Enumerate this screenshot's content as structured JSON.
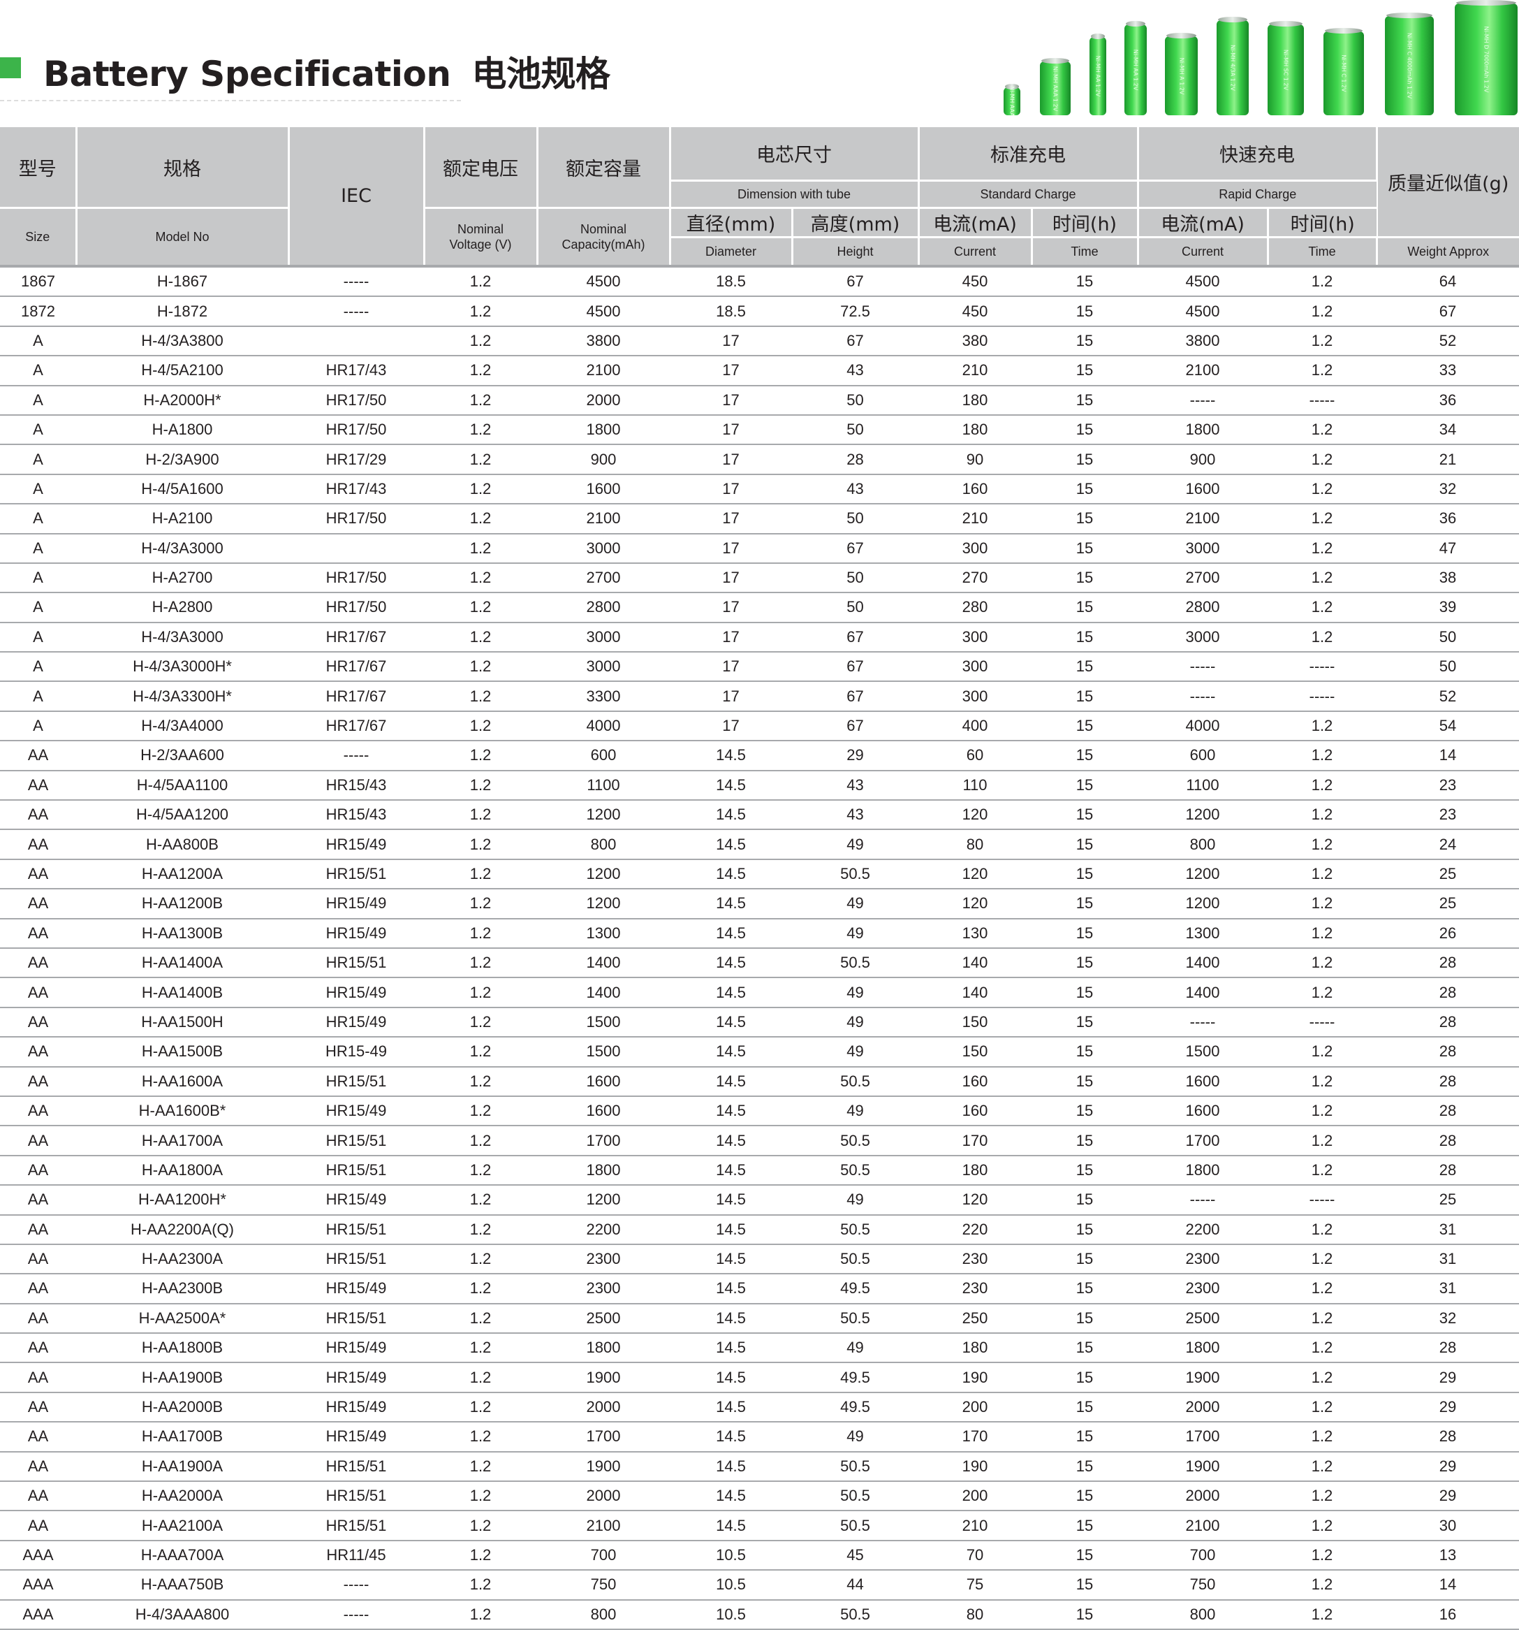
{
  "title": {
    "en": "Battery Specification",
    "zh": "电池规格"
  },
  "battery_labels": [
    "Ni-MH AAA",
    "Ni-MH AAA 1.2V",
    "Ni-MH AA 1.2V",
    "Ni-MH AA 1.2V",
    "Ni-MH A 1.2V",
    "Ni-MH 4/3A 1.2V",
    "Ni-MH SC 1.2V",
    "Ni-MH C 1.2V",
    "Ni-MH C 4000mAh 1.2V",
    "Ni-MH D 7000mAh 1.2V"
  ],
  "header": {
    "size": {
      "zh": "型号",
      "en": "Size"
    },
    "model": {
      "zh": "规格",
      "en": "Model No"
    },
    "iec": "IEC",
    "voltage": {
      "zh": "额定电压",
      "en1": "Nominal",
      "en2": "Voltage (V)"
    },
    "capacity": {
      "zh": "额定容量",
      "en1": "Nominal",
      "en2": "Capacity(mAh)"
    },
    "dimension": {
      "zh": "电芯尺寸",
      "en": "Dimension with tube"
    },
    "diameter": {
      "zh": "直径(mm)",
      "en": "Diameter"
    },
    "height": {
      "zh": "高度(mm)",
      "en": "Height"
    },
    "std_charge": {
      "zh": "标准充电",
      "en": "Standard Charge"
    },
    "std_current": {
      "zh": "电流(mA)",
      "en": "Current"
    },
    "std_time": {
      "zh": "时间(h)",
      "en": "Time"
    },
    "rapid_charge": {
      "zh": "快速充电",
      "en": "Rapid Charge"
    },
    "rapid_current": {
      "zh": "电流(mA)",
      "en": "Current"
    },
    "rapid_time": {
      "zh": "时间(h)",
      "en": "Time"
    },
    "weight": {
      "zh": "质量近似值(g)",
      "en": "Weight Approx"
    }
  },
  "rows": [
    [
      "1867",
      "H-1867",
      "-----",
      "1.2",
      "4500",
      "18.5",
      "67",
      "450",
      "15",
      "4500",
      "1.2",
      "64"
    ],
    [
      "1872",
      "H-1872",
      "-----",
      "1.2",
      "4500",
      "18.5",
      "72.5",
      "450",
      "15",
      "4500",
      "1.2",
      "67"
    ],
    [
      "A",
      "H-4/3A3800",
      "",
      "1.2",
      "3800",
      "17",
      "67",
      "380",
      "15",
      "3800",
      "1.2",
      "52"
    ],
    [
      "A",
      "H-4/5A2100",
      "HR17/43",
      "1.2",
      "2100",
      "17",
      "43",
      "210",
      "15",
      "2100",
      "1.2",
      "33"
    ],
    [
      "A",
      "H-A2000H*",
      "HR17/50",
      "1.2",
      "2000",
      "17",
      "50",
      "180",
      "15",
      "-----",
      "-----",
      "36"
    ],
    [
      "A",
      "H-A1800",
      "HR17/50",
      "1.2",
      "1800",
      "17",
      "50",
      "180",
      "15",
      "1800",
      "1.2",
      "34"
    ],
    [
      "A",
      "H-2/3A900",
      "HR17/29",
      "1.2",
      "900",
      "17",
      "28",
      "90",
      "15",
      "900",
      "1.2",
      "21"
    ],
    [
      "A",
      "H-4/5A1600",
      "HR17/43",
      "1.2",
      "1600",
      "17",
      "43",
      "160",
      "15",
      "1600",
      "1.2",
      "32"
    ],
    [
      "A",
      "H-A2100",
      "HR17/50",
      "1.2",
      "2100",
      "17",
      "50",
      "210",
      "15",
      "2100",
      "1.2",
      "36"
    ],
    [
      "A",
      "H-4/3A3000",
      "",
      "1.2",
      "3000",
      "17",
      "67",
      "300",
      "15",
      "3000",
      "1.2",
      "47"
    ],
    [
      "A",
      "H-A2700",
      "HR17/50",
      "1.2",
      "2700",
      "17",
      "50",
      "270",
      "15",
      "2700",
      "1.2",
      "38"
    ],
    [
      "A",
      "H-A2800",
      "HR17/50",
      "1.2",
      "2800",
      "17",
      "50",
      "280",
      "15",
      "2800",
      "1.2",
      "39"
    ],
    [
      "A",
      "H-4/3A3000",
      "HR17/67",
      "1.2",
      "3000",
      "17",
      "67",
      "300",
      "15",
      "3000",
      "1.2",
      "50"
    ],
    [
      "A",
      "H-4/3A3000H*",
      "HR17/67",
      "1.2",
      "3000",
      "17",
      "67",
      "300",
      "15",
      "-----",
      "-----",
      "50"
    ],
    [
      "A",
      "H-4/3A3300H*",
      "HR17/67",
      "1.2",
      "3300",
      "17",
      "67",
      "300",
      "15",
      "-----",
      "-----",
      "52"
    ],
    [
      "A",
      "H-4/3A4000",
      "HR17/67",
      "1.2",
      "4000",
      "17",
      "67",
      "400",
      "15",
      "4000",
      "1.2",
      "54"
    ],
    [
      "AA",
      "H-2/3AA600",
      "-----",
      "1.2",
      "600",
      "14.5",
      "29",
      "60",
      "15",
      "600",
      "1.2",
      "14"
    ],
    [
      "AA",
      "H-4/5AA1100",
      "HR15/43",
      "1.2",
      "1100",
      "14.5",
      "43",
      "110",
      "15",
      "1100",
      "1.2",
      "23"
    ],
    [
      "AA",
      "H-4/5AA1200",
      "HR15/43",
      "1.2",
      "1200",
      "14.5",
      "43",
      "120",
      "15",
      "1200",
      "1.2",
      "23"
    ],
    [
      "AA",
      "H-AA800B",
      "HR15/49",
      "1.2",
      "800",
      "14.5",
      "49",
      "80",
      "15",
      "800",
      "1.2",
      "24"
    ],
    [
      "AA",
      "H-AA1200A",
      "HR15/51",
      "1.2",
      "1200",
      "14.5",
      "50.5",
      "120",
      "15",
      "1200",
      "1.2",
      "25"
    ],
    [
      "AA",
      "H-AA1200B",
      "HR15/49",
      "1.2",
      "1200",
      "14.5",
      "49",
      "120",
      "15",
      "1200",
      "1.2",
      "25"
    ],
    [
      "AA",
      "H-AA1300B",
      "HR15/49",
      "1.2",
      "1300",
      "14.5",
      "49",
      "130",
      "15",
      "1300",
      "1.2",
      "26"
    ],
    [
      "AA",
      "H-AA1400A",
      "HR15/51",
      "1.2",
      "1400",
      "14.5",
      "50.5",
      "140",
      "15",
      "1400",
      "1.2",
      "28"
    ],
    [
      "AA",
      "H-AA1400B",
      "HR15/49",
      "1.2",
      "1400",
      "14.5",
      "49",
      "140",
      "15",
      "1400",
      "1.2",
      "28"
    ],
    [
      "AA",
      "H-AA1500H",
      "HR15/49",
      "1.2",
      "1500",
      "14.5",
      "49",
      "150",
      "15",
      "-----",
      "-----",
      "28"
    ],
    [
      "AA",
      "H-AA1500B",
      "HR15-49",
      "1.2",
      "1500",
      "14.5",
      "49",
      "150",
      "15",
      "1500",
      "1.2",
      "28"
    ],
    [
      "AA",
      "H-AA1600A",
      "HR15/51",
      "1.2",
      "1600",
      "14.5",
      "50.5",
      "160",
      "15",
      "1600",
      "1.2",
      "28"
    ],
    [
      "AA",
      "H-AA1600B*",
      "HR15/49",
      "1.2",
      "1600",
      "14.5",
      "49",
      "160",
      "15",
      "1600",
      "1.2",
      "28"
    ],
    [
      "AA",
      "H-AA1700A",
      "HR15/51",
      "1.2",
      "1700",
      "14.5",
      "50.5",
      "170",
      "15",
      "1700",
      "1.2",
      "28"
    ],
    [
      "AA",
      "H-AA1800A",
      "HR15/51",
      "1.2",
      "1800",
      "14.5",
      "50.5",
      "180",
      "15",
      "1800",
      "1.2",
      "28"
    ],
    [
      "AA",
      "H-AA1200H*",
      "HR15/49",
      "1.2",
      "1200",
      "14.5",
      "49",
      "120",
      "15",
      "-----",
      "-----",
      "25"
    ],
    [
      "AA",
      "H-AA2200A(Q)",
      "HR15/51",
      "1.2",
      "2200",
      "14.5",
      "50.5",
      "220",
      "15",
      "2200",
      "1.2",
      "31"
    ],
    [
      "AA",
      "H-AA2300A",
      "HR15/51",
      "1.2",
      "2300",
      "14.5",
      "50.5",
      "230",
      "15",
      "2300",
      "1.2",
      "31"
    ],
    [
      "AA",
      "H-AA2300B",
      "HR15/49",
      "1.2",
      "2300",
      "14.5",
      "49.5",
      "230",
      "15",
      "2300",
      "1.2",
      "31"
    ],
    [
      "AA",
      "H-AA2500A*",
      "HR15/51",
      "1.2",
      "2500",
      "14.5",
      "50.5",
      "250",
      "15",
      "2500",
      "1.2",
      "32"
    ],
    [
      "AA",
      "H-AA1800B",
      "HR15/49",
      "1.2",
      "1800",
      "14.5",
      "49",
      "180",
      "15",
      "1800",
      "1.2",
      "28"
    ],
    [
      "AA",
      "H-AA1900B",
      "HR15/49",
      "1.2",
      "1900",
      "14.5",
      "49.5",
      "190",
      "15",
      "1900",
      "1.2",
      "29"
    ],
    [
      "AA",
      "H-AA2000B",
      "HR15/49",
      "1.2",
      "2000",
      "14.5",
      "49.5",
      "200",
      "15",
      "2000",
      "1.2",
      "29"
    ],
    [
      "AA",
      "H-AA1700B",
      "HR15/49",
      "1.2",
      "1700",
      "14.5",
      "49",
      "170",
      "15",
      "1700",
      "1.2",
      "28"
    ],
    [
      "AA",
      "H-AA1900A",
      "HR15/51",
      "1.2",
      "1900",
      "14.5",
      "50.5",
      "190",
      "15",
      "1900",
      "1.2",
      "29"
    ],
    [
      "AA",
      "H-AA2000A",
      "HR15/51",
      "1.2",
      "2000",
      "14.5",
      "50.5",
      "200",
      "15",
      "2000",
      "1.2",
      "29"
    ],
    [
      "AA",
      "H-AA2100A",
      "HR15/51",
      "1.2",
      "2100",
      "14.5",
      "50.5",
      "210",
      "15",
      "2100",
      "1.2",
      "30"
    ],
    [
      "AAA",
      "H-AAA700A",
      "HR11/45",
      "1.2",
      "700",
      "10.5",
      "45",
      "70",
      "15",
      "700",
      "1.2",
      "13"
    ],
    [
      "AAA",
      "H-AAA750B",
      "-----",
      "1.2",
      "750",
      "10.5",
      "44",
      "75",
      "15",
      "750",
      "1.2",
      "14"
    ],
    [
      "AAA",
      "H-4/3AAA800",
      "-----",
      "1.2",
      "800",
      "10.5",
      "50.5",
      "80",
      "15",
      "800",
      "1.2",
      "16"
    ]
  ]
}
